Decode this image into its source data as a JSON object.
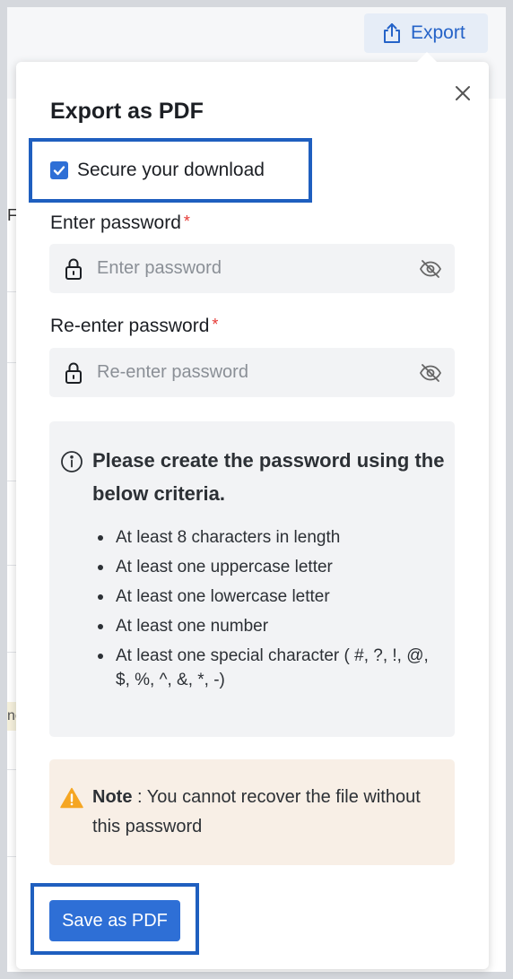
{
  "header": {
    "export_label": "Export"
  },
  "background": {
    "frag_1": "F",
    "frag_2": "nc"
  },
  "dialog": {
    "title": "Export as PDF",
    "secure_label": "Secure your download",
    "secure_checked": true,
    "password_label": "Enter password",
    "password_placeholder": "Enter password",
    "reenter_label": "Re-enter password",
    "reenter_placeholder": "Re-enter password",
    "required_mark": "*",
    "criteria_title": "Please create the password using the below criteria.",
    "criteria": [
      "At least 8 characters in length",
      "At least one uppercase letter",
      "At least one lowercase letter",
      "At least one number",
      "At least one special character ( #, ?, !, @, $, %, ^, &, *, -)"
    ],
    "note_label": "Note",
    "note_text": " : You cannot recover the file without this password",
    "save_label": "Save as PDF"
  },
  "colors": {
    "accent": "#2e6fd6",
    "highlight": "#1f5fbf",
    "required": "#e53935",
    "warning": "#f5a623"
  },
  "icons": {
    "export": "upload-icon",
    "close": "close-icon",
    "lock": "lock-icon",
    "eye": "eye-off-icon",
    "info": "info-icon",
    "warning": "warning-icon",
    "check": "check-icon"
  }
}
